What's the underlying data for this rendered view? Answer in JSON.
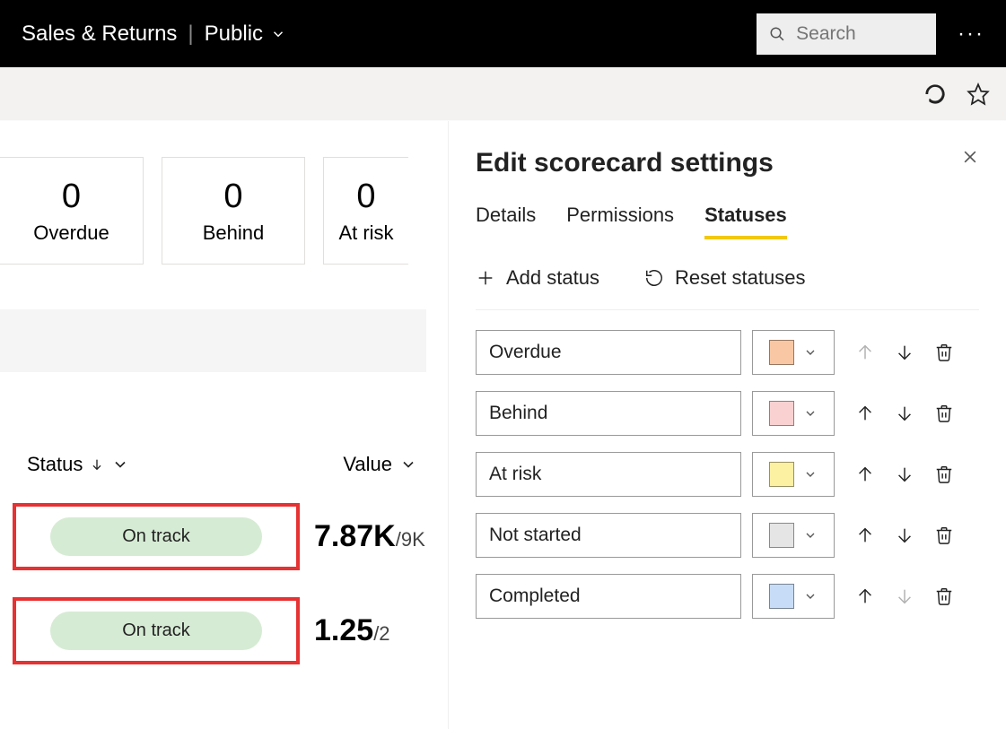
{
  "header": {
    "title": "Sales & Returns",
    "visibility": "Public",
    "search_placeholder": "Search"
  },
  "cards": [
    {
      "value": "0",
      "label": "Overdue"
    },
    {
      "value": "0",
      "label": "Behind"
    },
    {
      "value": "0",
      "label": "At risk"
    }
  ],
  "columns": {
    "status": "Status",
    "value": "Value"
  },
  "rows": [
    {
      "status": "On track",
      "value": "7.87K",
      "denom": "/9K"
    },
    {
      "status": "On track",
      "value": "1.25",
      "denom": "/2"
    }
  ],
  "panel": {
    "title": "Edit scorecard settings",
    "tabs": {
      "details": "Details",
      "permissions": "Permissions",
      "statuses": "Statuses"
    },
    "active_tab": "statuses",
    "add_status": "Add status",
    "reset_statuses": "Reset statuses",
    "statuses": [
      {
        "name": "Overdue",
        "color": "#f9c7a3",
        "up_disabled": true,
        "down_disabled": false
      },
      {
        "name": "Behind",
        "color": "#f9d1d1",
        "up_disabled": false,
        "down_disabled": false
      },
      {
        "name": "At risk",
        "color": "#fcf0a3",
        "up_disabled": false,
        "down_disabled": false
      },
      {
        "name": "Not started",
        "color": "#e5e5e5",
        "up_disabled": false,
        "down_disabled": false
      },
      {
        "name": "Completed",
        "color": "#c7ddf7",
        "up_disabled": false,
        "down_disabled": true
      }
    ]
  }
}
